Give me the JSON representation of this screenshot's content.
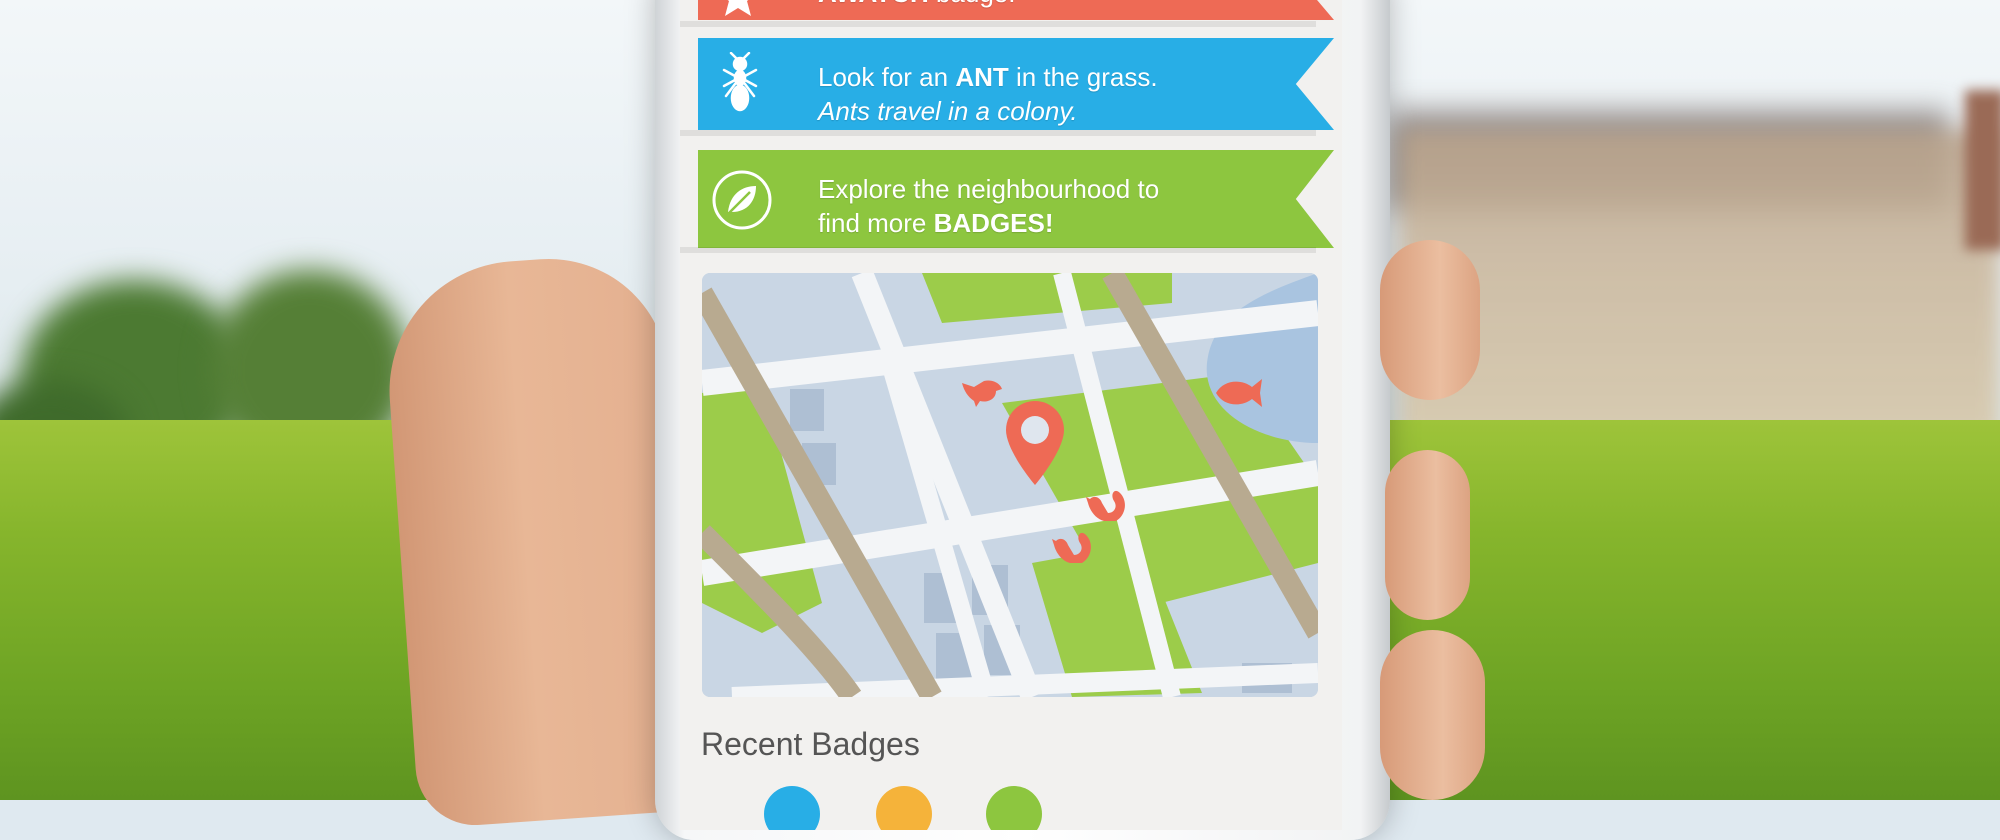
{
  "banners": [
    {
      "strong": "AWATCH",
      "rest": " badge!",
      "icon": "star-icon",
      "color": "#ee6a55"
    },
    {
      "line1_prefix": "Look for an ",
      "line1_strong": "ANT",
      "line1_suffix": " in the grass.",
      "line2": "Ants travel in a colony.",
      "icon": "ant-icon",
      "color": "#28aee6"
    },
    {
      "line1": "Explore the neighbourhood to",
      "line2_prefix": "find more ",
      "line2_strong": "BADGES!",
      "icon": "leaf-icon",
      "color": "#8dc63f"
    }
  ],
  "map": {
    "icons": [
      "bird-icon",
      "fish-icon",
      "location-pin-icon",
      "squirrel-icon",
      "squirrel-icon"
    ],
    "colors": {
      "road": "#b8aa90",
      "street": "#f3f5f7",
      "block": "#c9d6e4",
      "park": "#9ccc4a",
      "water": "#a9c4e0",
      "marker": "#ee6a55"
    }
  },
  "recent_badges": {
    "title": "Recent Badges"
  }
}
